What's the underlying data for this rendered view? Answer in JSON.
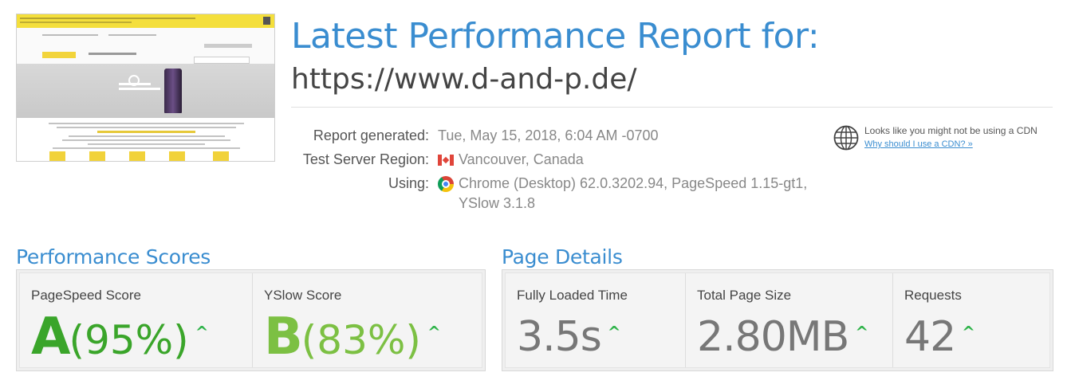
{
  "header": {
    "title": "Latest Performance Report for:",
    "url": "https://www.d-and-p.de/"
  },
  "meta": {
    "report_label": "Report generated:",
    "report_value": "Tue, May 15, 2018, 6:04 AM -0700",
    "region_label": "Test Server Region:",
    "region_value": "Vancouver, Canada",
    "using_label": "Using:",
    "using_value_line1": "Chrome (Desktop) 62.0.3202.94, PageSpeed 1.15-gt1,",
    "using_value_line2": "YSlow 3.1.8"
  },
  "cdn": {
    "message": "Looks like you might not be using a CDN",
    "link": "Why should I use a CDN? »"
  },
  "performance": {
    "title": "Performance Scores",
    "pagespeed_label": "PageSpeed Score",
    "pagespeed_grade": "A",
    "pagespeed_pct": "(95%)",
    "yslow_label": "YSlow Score",
    "yslow_grade": "B",
    "yslow_pct": "(83%)",
    "arrow": "^"
  },
  "details": {
    "title": "Page Details",
    "load_label": "Fully Loaded Time",
    "load_value": "3.5s",
    "size_label": "Total Page Size",
    "size_value": "2.80MB",
    "req_label": "Requests",
    "req_value": "42",
    "arrow": "^"
  },
  "colors": {
    "accent": "#3a8dd0",
    "grade_a": "#3aa52a",
    "grade_b": "#7cc043",
    "arrow": "#2fb34a"
  },
  "icons": {
    "cdn": "globe-icon",
    "region": "canada-flag-icon",
    "browser": "chrome-icon"
  }
}
